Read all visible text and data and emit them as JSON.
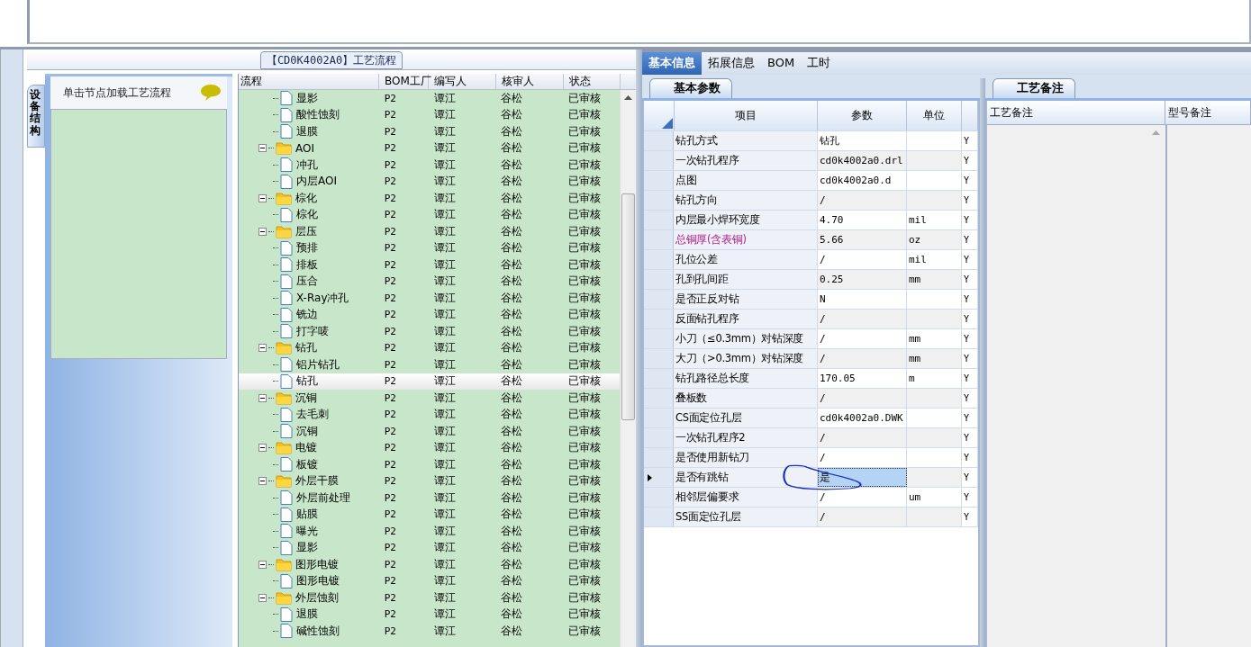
{
  "flow_panel": {
    "title": "【CD0K4002A0】工艺流程",
    "side_tab": "设备结构",
    "hint": "单击节点加载工艺流程"
  },
  "tree": {
    "columns": [
      "流程",
      "BOM工厂",
      "编写人",
      "核审人",
      "状态"
    ],
    "rows": [
      {
        "children": [
          {
            "name": "显影",
            "bom": "P2",
            "writer": "谭江",
            "reviewer": "谷松",
            "status": "已审核",
            "selected": false
          },
          {
            "name": "酸性蚀刻",
            "bom": "P2",
            "writer": "谭江",
            "reviewer": "谷松",
            "status": "已审核",
            "selected": false
          },
          {
            "name": "退膜",
            "bom": "P2",
            "writer": "谭江",
            "reviewer": "谷松",
            "status": "已审核",
            "selected": false
          }
        ]
      },
      {
        "name": "AOI",
        "bom": "P2",
        "writer": "谭江",
        "reviewer": "谷松",
        "status": "已审核",
        "selected": false,
        "expanded": true,
        "children": [
          {
            "name": "冲孔",
            "bom": "P2",
            "writer": "谭江",
            "reviewer": "谷松",
            "status": "已审核",
            "selected": false
          },
          {
            "name": "内层AOI",
            "bom": "P2",
            "writer": "谭江",
            "reviewer": "谷松",
            "status": "已审核",
            "selected": false
          }
        ]
      },
      {
        "name": "棕化",
        "bom": "P2",
        "writer": "谭江",
        "reviewer": "谷松",
        "status": "已审核",
        "selected": false,
        "expanded": true,
        "children": [
          {
            "name": "棕化",
            "bom": "P2",
            "writer": "谭江",
            "reviewer": "谷松",
            "status": "已审核",
            "selected": false
          }
        ]
      },
      {
        "name": "层压",
        "bom": "P2",
        "writer": "谭江",
        "reviewer": "谷松",
        "status": "已审核",
        "selected": false,
        "expanded": true,
        "children": [
          {
            "name": "预排",
            "bom": "P2",
            "writer": "谭江",
            "reviewer": "谷松",
            "status": "已审核",
            "selected": false
          },
          {
            "name": "排板",
            "bom": "P2",
            "writer": "谭江",
            "reviewer": "谷松",
            "status": "已审核",
            "selected": false
          },
          {
            "name": "压合",
            "bom": "P2",
            "writer": "谭江",
            "reviewer": "谷松",
            "status": "已审核",
            "selected": false
          },
          {
            "name": "X-Ray冲孔",
            "bom": "P2",
            "writer": "谭江",
            "reviewer": "谷松",
            "status": "已审核",
            "selected": false
          },
          {
            "name": "铣边",
            "bom": "P2",
            "writer": "谭江",
            "reviewer": "谷松",
            "status": "已审核",
            "selected": false
          },
          {
            "name": "打字唛",
            "bom": "P2",
            "writer": "谭江",
            "reviewer": "谷松",
            "status": "已审核",
            "selected": false
          }
        ]
      },
      {
        "name": "钻孔",
        "bom": "P2",
        "writer": "谭江",
        "reviewer": "谷松",
        "status": "已审核",
        "selected": false,
        "expanded": true,
        "children": [
          {
            "name": "铝片钻孔",
            "bom": "P2",
            "writer": "谭江",
            "reviewer": "谷松",
            "status": "已审核",
            "selected": false
          },
          {
            "name": "钻孔",
            "bom": "P2",
            "writer": "谭江",
            "reviewer": "谷松",
            "status": "已审核",
            "selected": true
          }
        ]
      },
      {
        "name": "沉铜",
        "bom": "P2",
        "writer": "谭江",
        "reviewer": "谷松",
        "status": "已审核",
        "selected": false,
        "expanded": true,
        "children": [
          {
            "name": "去毛刺",
            "bom": "P2",
            "writer": "谭江",
            "reviewer": "谷松",
            "status": "已审核",
            "selected": false
          },
          {
            "name": "沉铜",
            "bom": "P2",
            "writer": "谭江",
            "reviewer": "谷松",
            "status": "已审核",
            "selected": false
          }
        ]
      },
      {
        "name": "电镀",
        "bom": "P2",
        "writer": "谭江",
        "reviewer": "谷松",
        "status": "已审核",
        "selected": false,
        "expanded": true,
        "children": [
          {
            "name": "板镀",
            "bom": "P2",
            "writer": "谭江",
            "reviewer": "谷松",
            "status": "已审核",
            "selected": false
          }
        ]
      },
      {
        "name": "外层干膜",
        "bom": "P2",
        "writer": "谭江",
        "reviewer": "谷松",
        "status": "已审核",
        "selected": false,
        "expanded": true,
        "children": [
          {
            "name": "外层前处理",
            "bom": "P2",
            "writer": "谭江",
            "reviewer": "谷松",
            "status": "已审核",
            "selected": false
          },
          {
            "name": "贴膜",
            "bom": "P2",
            "writer": "谭江",
            "reviewer": "谷松",
            "status": "已审核",
            "selected": false
          },
          {
            "name": "曝光",
            "bom": "P2",
            "writer": "谭江",
            "reviewer": "谷松",
            "status": "已审核",
            "selected": false
          },
          {
            "name": "显影",
            "bom": "P2",
            "writer": "谭江",
            "reviewer": "谷松",
            "status": "已审核",
            "selected": false
          }
        ]
      },
      {
        "name": "图形电镀",
        "bom": "P2",
        "writer": "谭江",
        "reviewer": "谷松",
        "status": "已审核",
        "selected": false,
        "expanded": true,
        "children": [
          {
            "name": "图形电镀",
            "bom": "P2",
            "writer": "谭江",
            "reviewer": "谷松",
            "status": "已审核",
            "selected": false
          }
        ]
      },
      {
        "name": "外层蚀刻",
        "bom": "P2",
        "writer": "谭江",
        "reviewer": "谷松",
        "status": "已审核",
        "selected": false,
        "expanded": true,
        "children": [
          {
            "name": "退膜",
            "bom": "P2",
            "writer": "谭江",
            "reviewer": "谷松",
            "status": "已审核",
            "selected": false
          },
          {
            "name": "碱性蚀刻",
            "bom": "P2",
            "writer": "谭江",
            "reviewer": "谷松",
            "status": "已审核",
            "selected": false
          }
        ]
      }
    ]
  },
  "tabs": [
    {
      "label": "基本信息",
      "selected": true
    },
    {
      "label": "拓展信息",
      "selected": false
    },
    {
      "label": "BOM",
      "selected": false
    },
    {
      "label": "工时",
      "selected": false
    }
  ],
  "params": {
    "tab": "基本参数",
    "columns": [
      "项目",
      "参数",
      "单位"
    ],
    "rows": [
      {
        "item": "钻孔方式",
        "value": "钻孔",
        "unit": "",
        "flag": "Y",
        "highlighted": false,
        "selected": false
      },
      {
        "item": "一次钻孔程序",
        "value": "cd0k4002a0.drl",
        "unit": "",
        "flag": "Y",
        "highlighted": false,
        "selected": false
      },
      {
        "item": "点图",
        "value": "cd0k4002a0.d",
        "unit": "",
        "flag": "Y",
        "highlighted": false,
        "selected": false
      },
      {
        "item": "钻孔方向",
        "value": "/",
        "unit": "",
        "flag": "Y",
        "highlighted": false,
        "selected": false
      },
      {
        "item": "内层最小焊环宽度",
        "value": "4.70",
        "unit": "mil",
        "flag": "Y",
        "highlighted": false,
        "selected": false
      },
      {
        "item": "总铜厚(含表铜)",
        "value": "5.66",
        "unit": "oz",
        "flag": "Y",
        "highlighted": true,
        "selected": false
      },
      {
        "item": "孔位公差",
        "value": "/",
        "unit": "mil",
        "flag": "Y",
        "highlighted": false,
        "selected": false
      },
      {
        "item": "孔到孔间距",
        "value": "0.25",
        "unit": "mm",
        "flag": "Y",
        "highlighted": false,
        "selected": false
      },
      {
        "item": "是否正反对钻",
        "value": "N",
        "unit": "",
        "flag": "Y",
        "highlighted": false,
        "selected": false
      },
      {
        "item": "反面钻孔程序",
        "value": "/",
        "unit": "",
        "flag": "Y",
        "highlighted": false,
        "selected": false
      },
      {
        "item": "小刀（≤0.3mm）对钻深度",
        "value": "/",
        "unit": "mm",
        "flag": "Y",
        "highlighted": false,
        "selected": false
      },
      {
        "item": "大刀（>0.3mm）对钻深度",
        "value": "/",
        "unit": "mm",
        "flag": "Y",
        "highlighted": false,
        "selected": false
      },
      {
        "item": "钻孔路径总长度",
        "value": "170.05",
        "unit": "m",
        "flag": "Y",
        "highlighted": false,
        "selected": false
      },
      {
        "item": "叠板数",
        "value": "/",
        "unit": "",
        "flag": "Y",
        "highlighted": false,
        "selected": false
      },
      {
        "item": "CS面定位孔层",
        "value": "cd0k4002a0.DWK",
        "unit": "",
        "flag": "Y",
        "highlighted": false,
        "selected": false
      },
      {
        "item": "一次钻孔程序2",
        "value": "/",
        "unit": "",
        "flag": "Y",
        "highlighted": false,
        "selected": false
      },
      {
        "item": "是否使用新钻刀",
        "value": "/",
        "unit": "",
        "flag": "Y",
        "highlighted": false,
        "selected": false
      },
      {
        "item": "是否有跳钻",
        "value": "是",
        "unit": "",
        "flag": "Y",
        "highlighted": false,
        "selected": true
      },
      {
        "item": "相邻层偏要求",
        "value": "/",
        "unit": "um",
        "flag": "Y",
        "highlighted": false,
        "selected": false
      },
      {
        "item": "SS面定位孔层",
        "value": "/",
        "unit": "",
        "flag": "Y",
        "highlighted": false,
        "selected": false
      }
    ]
  },
  "notes": {
    "tab": "工艺备注",
    "columns": [
      "工艺备注",
      "型号备注"
    ]
  }
}
